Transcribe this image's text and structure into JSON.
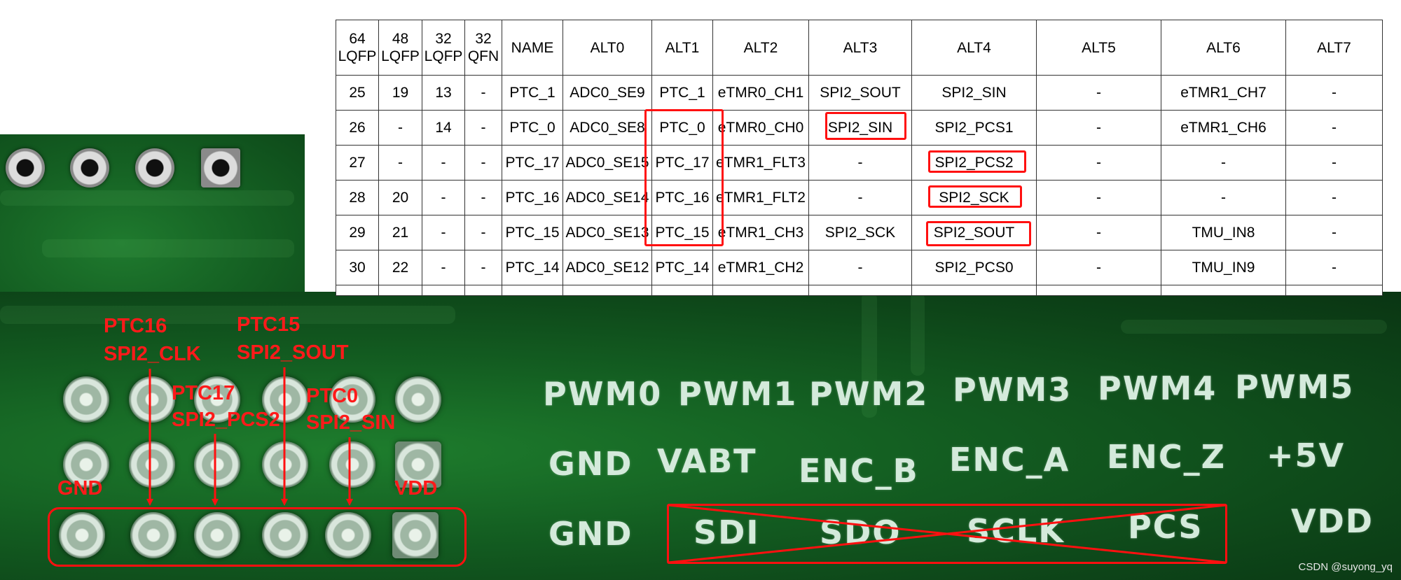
{
  "table": {
    "headers": [
      "64 LQFP",
      "48 LQFP",
      "32 LQFP",
      "32 QFN",
      "NAME",
      "ALT0",
      "ALT1",
      "ALT2",
      "ALT3",
      "ALT4",
      "ALT5",
      "ALT6",
      "ALT7"
    ],
    "rows": [
      [
        "25",
        "19",
        "13",
        "-",
        "PTC_1",
        "ADC0_SE9",
        "PTC_1",
        "eTMR0_CH1",
        "SPI2_SOUT",
        "SPI2_SIN",
        "-",
        "eTMR1_CH7",
        "-"
      ],
      [
        "26",
        "-",
        "14",
        "-",
        "PTC_0",
        "ADC0_SE8",
        "PTC_0",
        "eTMR0_CH0",
        "SPI2_SIN",
        "SPI2_PCS1",
        "-",
        "eTMR1_CH6",
        "-"
      ],
      [
        "27",
        "-",
        "-",
        "-",
        "PTC_17",
        "ADC0_SE15",
        "PTC_17",
        "eTMR1_FLT3",
        "-",
        "SPI2_PCS2",
        "-",
        "-",
        "-"
      ],
      [
        "28",
        "20",
        "-",
        "-",
        "PTC_16",
        "ADC0_SE14",
        "PTC_16",
        "eTMR1_FLT2",
        "-",
        "SPI2_SCK",
        "-",
        "-",
        "-"
      ],
      [
        "29",
        "21",
        "-",
        "-",
        "PTC_15",
        "ADC0_SE13",
        "PTC_15",
        "eTMR1_CH3",
        "SPI2_SCK",
        "SPI2_SOUT",
        "-",
        "TMU_IN8",
        "-"
      ],
      [
        "30",
        "22",
        "-",
        "-",
        "PTC_14",
        "ADC0_SE12",
        "PTC_14",
        "eTMR1_CH2",
        "-",
        "SPI2_PCS0",
        "-",
        "TMU_IN9",
        "-"
      ]
    ]
  },
  "annotations": {
    "ptc16": "PTC16",
    "spi2_clk": "SPI2_CLK",
    "ptc15": "PTC15",
    "spi2_sout": "SPI2_SOUT",
    "ptc17": "PTC17",
    "spi2_pcs2": "SPI2_PCS2",
    "ptc0": "PTC0",
    "spi2_sin": "SPI2_SIN",
    "gnd": "GND",
    "vdd": "VDD"
  },
  "silkscreen": {
    "row1": [
      "PWM0",
      "PWM1",
      "PWM2",
      "PWM3",
      "PWM4",
      "PWM5"
    ],
    "row2": [
      "GND",
      "VABT",
      "ENC_B",
      "ENC_A",
      "ENC_Z",
      "+5V"
    ],
    "row3": [
      "GND",
      "SDI",
      "SDO",
      "SCLK",
      "PCS",
      "VDD"
    ]
  },
  "watermark": "CSDN @suyong_yq",
  "colors": {
    "annotation_red": "#ff1a1a",
    "board_green": "#145f22",
    "silkscreen_white": "#d4eadb"
  }
}
